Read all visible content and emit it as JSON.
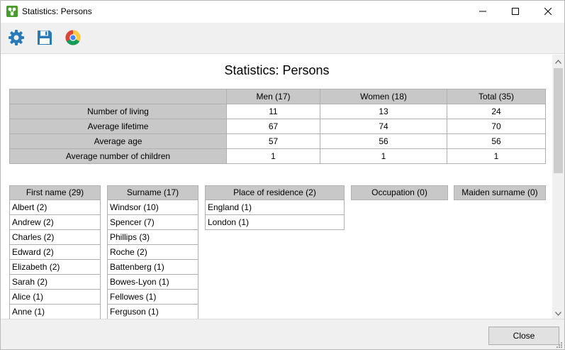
{
  "window": {
    "title": "Statistics: Persons"
  },
  "toolbar": {
    "icons": [
      "gear-icon",
      "save-icon",
      "chrome-icon"
    ]
  },
  "report": {
    "title": "Statistics: Persons",
    "columns": [
      "Men (17)",
      "Women (18)",
      "Total (35)"
    ],
    "rows": [
      {
        "label": "Number of living",
        "values": [
          "11",
          "13",
          "24"
        ]
      },
      {
        "label": "Average lifetime",
        "values": [
          "67",
          "74",
          "70"
        ]
      },
      {
        "label": "Average age",
        "values": [
          "57",
          "56",
          "56"
        ]
      },
      {
        "label": "Average number of children",
        "values": [
          "1",
          "1",
          "1"
        ]
      }
    ]
  },
  "lists": {
    "first_name": {
      "header": "First name (29)",
      "items": [
        "Albert (2)",
        "Andrew (2)",
        "Charles (2)",
        "Edward (2)",
        "Elizabeth (2)",
        "Sarah (2)",
        "Alice (1)",
        "Anne (1)"
      ]
    },
    "surname": {
      "header": "Surname (17)",
      "items": [
        "Windsor (10)",
        "Spencer (7)",
        "Phillips (3)",
        "Roche (2)",
        "Battenberg (1)",
        "Bowes-Lyon (1)",
        "Fellowes (1)",
        "Ferguson (1)"
      ]
    },
    "residence": {
      "header": "Place of residence (2)",
      "items": [
        "England (1)",
        "London (1)"
      ]
    },
    "occupation": {
      "header": "Occupation (0)",
      "items": []
    },
    "maiden": {
      "header": "Maiden surname (0)",
      "items": []
    }
  },
  "footer": {
    "close_label": "Close"
  },
  "colors": {
    "header_bg": "#c8c8c8",
    "chrome_bg": "#f0f0f0",
    "accent": "#2a7ab8"
  }
}
